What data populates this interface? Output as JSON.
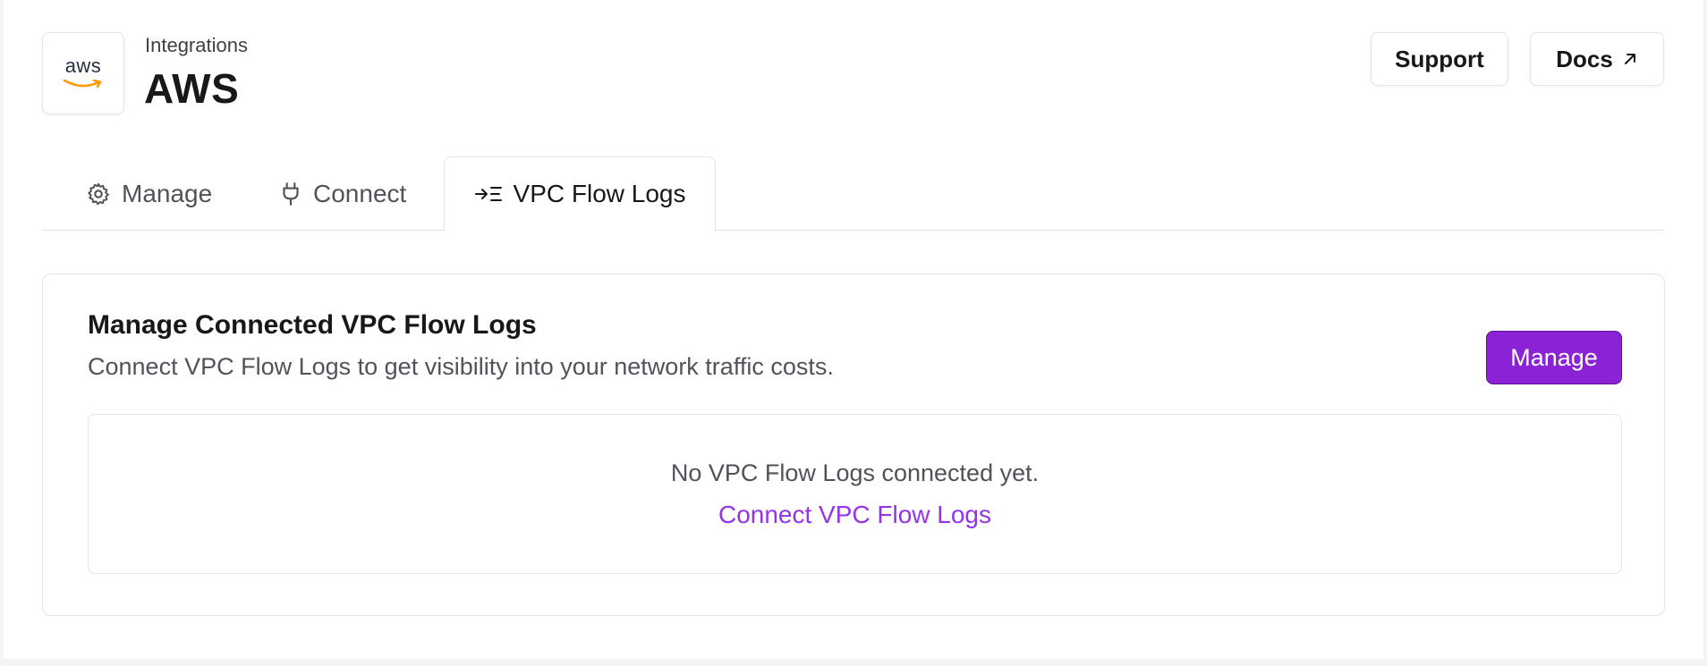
{
  "header": {
    "logo_text": "aws",
    "breadcrumb": "Integrations",
    "title": "AWS",
    "support_label": "Support",
    "docs_label": "Docs",
    "docs_icon": "arrow-up-right-icon"
  },
  "tabs": [
    {
      "label": "Manage",
      "icon": "gear-icon",
      "active": false
    },
    {
      "label": "Connect",
      "icon": "plug-icon",
      "active": false
    },
    {
      "label": "VPC Flow Logs",
      "icon": "arrow-into-list-icon",
      "active": true
    }
  ],
  "card": {
    "title": "Manage Connected VPC Flow Logs",
    "subtitle": "Connect VPC Flow Logs to get visibility into your network traffic costs.",
    "manage_label": "Manage",
    "empty_text": "No VPC Flow Logs connected yet.",
    "empty_link": "Connect VPC Flow Logs"
  },
  "colors": {
    "accent": "#8b22d6",
    "link": "#9333ea",
    "aws_orange": "#ff9900",
    "border": "#e4e4e7"
  }
}
